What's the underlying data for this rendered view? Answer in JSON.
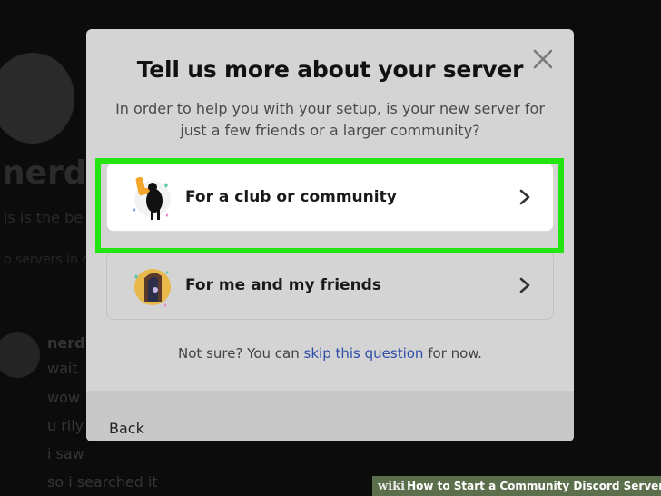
{
  "background": {
    "server_name_partial": "nerddc",
    "description_partial": "is is the be",
    "hint_partial": "o servers in c",
    "message_user": "nerd",
    "messages": [
      "wait",
      "wow",
      "u rlly",
      "i saw",
      "so i searched it"
    ]
  },
  "modal": {
    "title": "Tell us more about your server",
    "subtitle": "In order to help you with your setup, is your new server for just a few friends or a larger community?",
    "options": [
      {
        "label": "For a club or community",
        "icon": "club-community-illustration-icon"
      },
      {
        "label": "For me and my friends",
        "icon": "friends-illustration-icon"
      }
    ],
    "not_sure_prefix": "Not sure? You can",
    "skip_link": "skip this question",
    "not_sure_suffix": "for now.",
    "back_label": "Back",
    "highlight_color": "#24e512"
  },
  "watermark": {
    "brand": "wiki",
    "title": "How to Start a Community Discord Server"
  }
}
